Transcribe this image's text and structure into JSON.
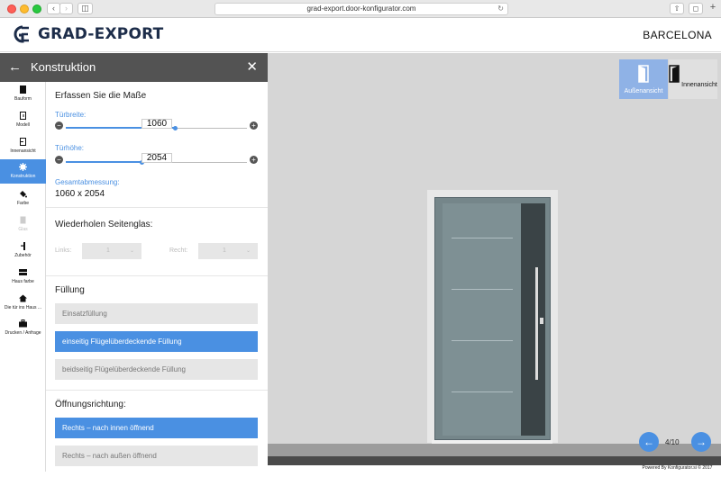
{
  "browser": {
    "url": "grad-export.door-konfigurator.com",
    "back_icon": "chevron-left",
    "forward_icon": "chevron-right"
  },
  "header": {
    "brand": "GRAD-EXPORT",
    "product": "BARCELONA"
  },
  "panel": {
    "title": "Konstruktion"
  },
  "nav": {
    "items": [
      {
        "label": "Bauform",
        "icon": "square-icon"
      },
      {
        "label": "Modell",
        "icon": "door-model-icon"
      },
      {
        "label": "Innenansicht",
        "icon": "door-inside-icon"
      },
      {
        "label": "Konstruktion",
        "icon": "gear-icon"
      },
      {
        "label": "Farbe",
        "icon": "paint-bucket-icon"
      },
      {
        "label": "Glas",
        "icon": "glass-icon"
      },
      {
        "label": "Zubehör",
        "icon": "handle-icon"
      },
      {
        "label": "Haus farbe",
        "icon": "house-color-icon"
      },
      {
        "label": "Die tür ins Haus ...",
        "icon": "house-icon"
      },
      {
        "label": "Drucken / Anfrage",
        "icon": "briefcase-icon"
      }
    ]
  },
  "measure": {
    "title": "Erfassen Sie die Maße",
    "width_label": "Türbreite:",
    "width_value": "1060",
    "width_fraction": 0.6,
    "height_label": "Türhöhe:",
    "height_value": "2054",
    "height_fraction": 0.42,
    "total_label": "Gesamtabmessung:",
    "total_value": "1060 x 2054"
  },
  "sideglass": {
    "title": "Wiederholen Seitenglas:",
    "left_label": "Links:",
    "left_value": "1",
    "right_label": "Recht:",
    "right_value": "1"
  },
  "filling": {
    "title": "Füllung",
    "options": [
      {
        "label": "Einsatzfüllung",
        "selected": false
      },
      {
        "label": "einseitig Flügelüberdeckende Füllung",
        "selected": true
      },
      {
        "label": "beidseitig Flügelüberdeckende Füllung",
        "selected": false
      }
    ]
  },
  "opening": {
    "title": "Öffnungsrichtung:",
    "options": [
      {
        "label": "Rechts – nach innen öffnend",
        "selected": true
      },
      {
        "label": "Rechts – nach außen öffnend",
        "selected": false
      }
    ]
  },
  "preview": {
    "view_outside": "Außenansicht",
    "view_inside": "Innenansicht",
    "pager": "4/10",
    "powered_by": "Powered By Konfigurator.si © 2017"
  },
  "colors": {
    "accent": "#4a90e2",
    "panel_header": "#535353",
    "brand": "#1d2d4a"
  }
}
